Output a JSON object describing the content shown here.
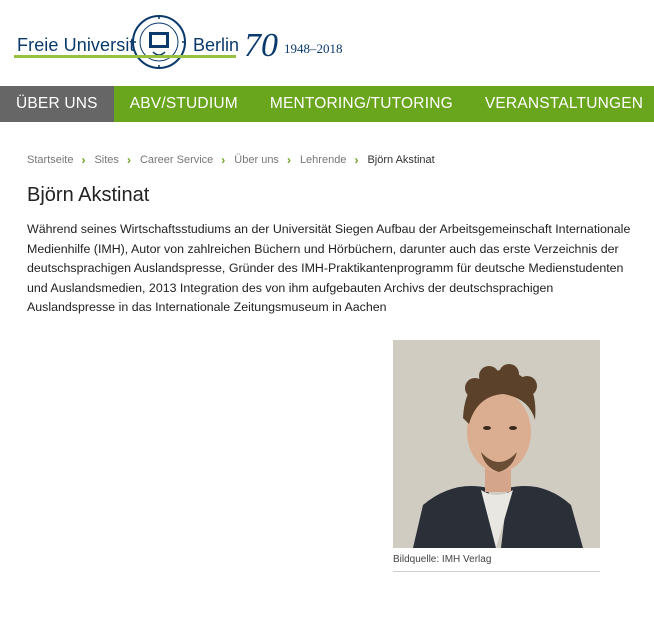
{
  "header": {
    "brand_left": "Freie Universität",
    "brand_right": "Berlin",
    "anniv_number": "70",
    "anniv_years": "1948–2018",
    "colors": {
      "brand_blue": "#0a3a6b",
      "brand_green": "#99c140"
    }
  },
  "nav": {
    "color": "#6aa51e",
    "active_color": "#666666",
    "items": [
      {
        "label": "ÜBER UNS"
      },
      {
        "label": "ABV/STUDIUM"
      },
      {
        "label": "MENTORING/TUTORING"
      },
      {
        "label": "VERANSTALTUNGEN"
      }
    ]
  },
  "breadcrumb": {
    "items": [
      "Startseite",
      "Sites",
      "Career Service",
      "Über uns",
      "Lehrende"
    ],
    "current": "Björn Akstinat"
  },
  "main": {
    "title": "Björn Akstinat",
    "intro": "Während seines Wirtschaftsstudiums an der Universität Siegen Aufbau der Arbeitsgemeinschaft Internationale Medienhilfe (IMH), Autor von zahlreichen Büchern und Hörbüchern, darunter auch das erste Verzeichnis der deutschsprachigen Auslandspresse, Gründer des IMH-Praktikantenprogramm für deutsche Medienstudenten und Auslandsmedien, 2013 Integration des von ihm aufgebauten Archivs der deutschsprachigen Auslandspresse in das Internationale Zeitungsmuseum in Aachen",
    "photo_caption": "Bildquelle: IMH Verlag"
  }
}
